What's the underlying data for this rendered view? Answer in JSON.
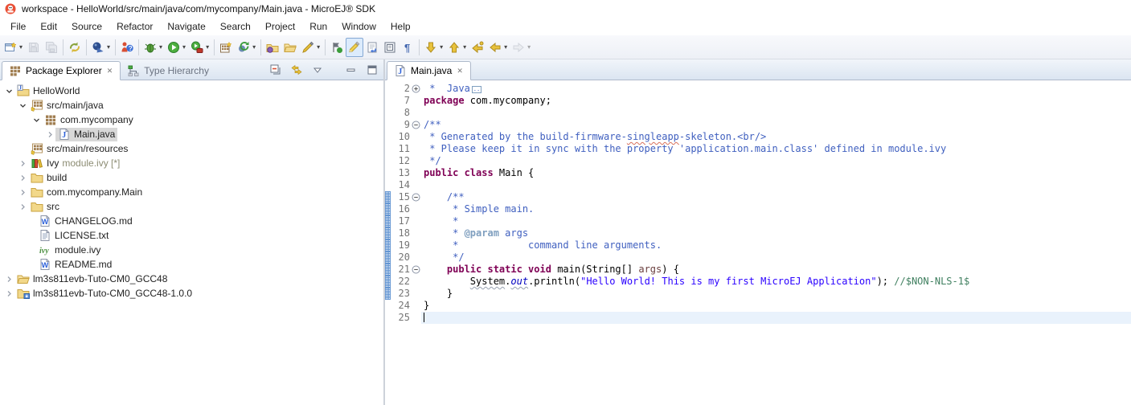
{
  "window": {
    "title": "workspace - HelloWorld/src/main/java/com/mycompany/Main.java - MicroEJ® SDK"
  },
  "menu": [
    "File",
    "Edit",
    "Source",
    "Refactor",
    "Navigate",
    "Search",
    "Project",
    "Run",
    "Window",
    "Help"
  ],
  "toolbar": [
    {
      "type": "button",
      "name": "new-wizard",
      "icon": "new-wizard-icon",
      "dropdown": true
    },
    {
      "type": "button",
      "name": "save",
      "icon": "save-icon",
      "disabled": true
    },
    {
      "type": "button",
      "name": "save-all",
      "icon": "save-all-icon",
      "disabled": true
    },
    {
      "type": "sep"
    },
    {
      "type": "button",
      "name": "refresh",
      "icon": "refresh-icon"
    },
    {
      "type": "sep"
    },
    {
      "type": "button",
      "name": "microej-build",
      "icon": "microej-build-icon",
      "dropdown": true
    },
    {
      "type": "sep"
    },
    {
      "type": "button",
      "name": "support",
      "icon": "support-icon"
    },
    {
      "type": "sep"
    },
    {
      "type": "button",
      "name": "debug",
      "icon": "debug-icon",
      "dropdown": true
    },
    {
      "type": "button",
      "name": "run",
      "icon": "run-icon",
      "dropdown": true
    },
    {
      "type": "button",
      "name": "external-tools",
      "icon": "external-tools-icon",
      "dropdown": true
    },
    {
      "type": "sep"
    },
    {
      "type": "button",
      "name": "new-java-project",
      "icon": "new-java-project-icon"
    },
    {
      "type": "button",
      "name": "resolve",
      "icon": "resolve-icon",
      "dropdown": true
    },
    {
      "type": "sep"
    },
    {
      "type": "button",
      "name": "import",
      "icon": "import-icon"
    },
    {
      "type": "button",
      "name": "open-folder",
      "icon": "open-folder-icon"
    },
    {
      "type": "button",
      "name": "format",
      "icon": "format-icon",
      "dropdown": true
    },
    {
      "type": "sep"
    },
    {
      "type": "button",
      "name": "next-change",
      "icon": "next-change-icon"
    },
    {
      "type": "button",
      "name": "mark-occurrences",
      "icon": "mark-occurrences-icon",
      "active": true
    },
    {
      "type": "button",
      "name": "show-selected-element",
      "icon": "show-selected-icon"
    },
    {
      "type": "button",
      "name": "show-source",
      "icon": "show-source-icon"
    },
    {
      "type": "button",
      "name": "show-whitespace",
      "icon": "whitespace-icon"
    },
    {
      "type": "sep"
    },
    {
      "type": "button",
      "name": "next-annotation",
      "icon": "next-annotation-icon",
      "dropdown": true
    },
    {
      "type": "button",
      "name": "previous-annotation",
      "icon": "previous-annotation-icon",
      "dropdown": true
    },
    {
      "type": "button",
      "name": "last-edit-location",
      "icon": "last-edit-icon"
    },
    {
      "type": "button",
      "name": "back",
      "icon": "back-icon",
      "dropdown": true
    },
    {
      "type": "button",
      "name": "forward",
      "icon": "forward-icon",
      "dropdown": true,
      "disabled": true
    }
  ],
  "explorer": {
    "tabs": [
      {
        "label": "Package Explorer",
        "icon": "package-explorer-icon",
        "active": true,
        "closable": true
      },
      {
        "label": "Type Hierarchy",
        "icon": "type-hierarchy-icon",
        "active": false,
        "closable": false
      }
    ],
    "actions": [
      {
        "name": "collapse-all",
        "icon": "collapse-all-icon"
      },
      {
        "name": "link-with-editor",
        "icon": "link-with-editor-icon"
      },
      {
        "name": "view-menu",
        "icon": "view-menu-icon"
      },
      {
        "name": "minimize",
        "icon": "minimize-icon"
      },
      {
        "name": "maximize",
        "icon": "maximize-icon"
      }
    ],
    "tree": [
      {
        "label": "HelloWorld",
        "level": 0,
        "arrow": "expanded",
        "icon": "java-project-icon"
      },
      {
        "label": "src/main/java",
        "level": 1,
        "arrow": "expanded",
        "icon": "src-folder-icon"
      },
      {
        "label": "com.mycompany",
        "level": 2,
        "arrow": "expanded",
        "icon": "package-icon"
      },
      {
        "label": "Main.java",
        "level": 3,
        "arrow": "collapsed",
        "icon": "java-file-icon",
        "selected": true
      },
      {
        "label": "src/main/resources",
        "level": 1,
        "arrow": null,
        "icon": "src-folder-icon"
      },
      {
        "label": "Ivy",
        "suffix": " module.ivy [*]",
        "level": 1,
        "arrow": "collapsed",
        "icon": "library-icon"
      },
      {
        "label": "build",
        "level": 1,
        "arrow": "collapsed",
        "icon": "folder-icon"
      },
      {
        "label": "com.mycompany.Main",
        "level": 1,
        "arrow": "collapsed",
        "icon": "folder-icon"
      },
      {
        "label": "src",
        "level": 1,
        "arrow": "collapsed",
        "icon": "folder-icon"
      },
      {
        "label": "CHANGELOG.md",
        "level": 1,
        "arrow": null,
        "icon": "wikitext-file-icon",
        "leaf": true
      },
      {
        "label": "LICENSE.txt",
        "level": 1,
        "arrow": null,
        "icon": "text-file-icon",
        "leaf": true
      },
      {
        "label": "module.ivy",
        "level": 1,
        "arrow": null,
        "icon": "ivy-file-icon",
        "leaf": true
      },
      {
        "label": "README.md",
        "level": 1,
        "arrow": null,
        "icon": "wikitext-file-icon",
        "leaf": true
      },
      {
        "label": "lm3s811evb-Tuto-CM0_GCC48",
        "level": 0,
        "arrow": "collapsed",
        "icon": "folder-open-icon"
      },
      {
        "label": "lm3s811evb-Tuto-CM0_GCC48-1.0.0",
        "level": 0,
        "arrow": "collapsed",
        "icon": "folder-version-icon"
      }
    ]
  },
  "editor": {
    "tabs": [
      {
        "label": "Main.java",
        "icon": "java-file-icon",
        "active": true,
        "closable": true
      }
    ],
    "lines": [
      {
        "num": 2,
        "fold": "plus",
        "segments": [
          {
            "t": " *  Java",
            "s": "doc"
          },
          {
            "t": "..",
            "s": "box"
          }
        ]
      },
      {
        "num": 7,
        "segments": [
          {
            "t": "package ",
            "s": "kw"
          },
          {
            "t": "com.mycompany;",
            "s": "pl"
          }
        ]
      },
      {
        "num": 8,
        "segments": []
      },
      {
        "num": 9,
        "fold": "minus",
        "segments": [
          {
            "t": "/**",
            "s": "doc"
          }
        ]
      },
      {
        "num": 10,
        "segments": [
          {
            "t": " * Generated by the build-firmware-",
            "s": "doc"
          },
          {
            "t": "singleapp",
            "s": "doc sp"
          },
          {
            "t": "-skeleton.<br/>",
            "s": "doc"
          }
        ]
      },
      {
        "num": 11,
        "segments": [
          {
            "t": " * Please keep it in sync with the property 'application.main.class' defined in module.ivy",
            "s": "doc"
          }
        ]
      },
      {
        "num": 12,
        "segments": [
          {
            "t": " */",
            "s": "doc"
          }
        ]
      },
      {
        "num": 13,
        "segments": [
          {
            "t": "public class ",
            "s": "kw"
          },
          {
            "t": "Main {",
            "s": "pl"
          }
        ]
      },
      {
        "num": 14,
        "segments": []
      },
      {
        "num": 15,
        "fold": "minus",
        "diff": true,
        "segments": [
          {
            "t": "    ",
            "s": "pl"
          },
          {
            "t": "/**",
            "s": "doc"
          }
        ]
      },
      {
        "num": 16,
        "diff": true,
        "segments": [
          {
            "t": "     * Simple main.",
            "s": "doc"
          }
        ]
      },
      {
        "num": 17,
        "diff": true,
        "segments": [
          {
            "t": "     *",
            "s": "doc"
          }
        ]
      },
      {
        "num": 18,
        "diff": true,
        "segments": [
          {
            "t": "     * ",
            "s": "doc"
          },
          {
            "t": "@param",
            "s": "tag"
          },
          {
            "t": " args",
            "s": "doc"
          }
        ]
      },
      {
        "num": 19,
        "diff": true,
        "segments": [
          {
            "t": "     *            command line arguments.",
            "s": "doc"
          }
        ]
      },
      {
        "num": 20,
        "diff": true,
        "segments": [
          {
            "t": "     */",
            "s": "doc"
          }
        ]
      },
      {
        "num": 21,
        "fold": "minus",
        "diff": true,
        "segments": [
          {
            "t": "    ",
            "s": "pl"
          },
          {
            "t": "public static void ",
            "s": "kw"
          },
          {
            "t": "main(String[] ",
            "s": "pl"
          },
          {
            "t": "args",
            "s": "par"
          },
          {
            "t": ") {",
            "s": "pl"
          }
        ]
      },
      {
        "num": 22,
        "diff": true,
        "segments": [
          {
            "t": "        ",
            "s": "pl"
          },
          {
            "t": "System",
            "s": "pl wv"
          },
          {
            "t": ".",
            "s": "pl"
          },
          {
            "t": "out",
            "s": "sf wv"
          },
          {
            "t": ".println(",
            "s": "pl"
          },
          {
            "t": "\"Hello World! This is my first MicroEJ Application\"",
            "s": "str"
          },
          {
            "t": "); ",
            "s": "pl"
          },
          {
            "t": "//$NON-NLS-1$",
            "s": "nls"
          }
        ]
      },
      {
        "num": 23,
        "diff": true,
        "segments": [
          {
            "t": "    }",
            "s": "pl"
          }
        ]
      },
      {
        "num": 24,
        "segments": [
          {
            "t": "}",
            "s": "pl"
          }
        ]
      },
      {
        "num": 25,
        "current": true,
        "caret": true,
        "segments": []
      }
    ]
  },
  "colors": {
    "keyword": "#7F0055",
    "javadoc": "#3F5FBF",
    "javadoc_tag": "#7F9FBF",
    "string": "#2A00FF",
    "nls_comment": "#3F7F5F",
    "static_field": "#0000C0",
    "parameter": "#6A3E3E",
    "line_number": "#757575",
    "current_line_bg": "#E9F2FC",
    "selection_bg": "#D8D8D8"
  }
}
